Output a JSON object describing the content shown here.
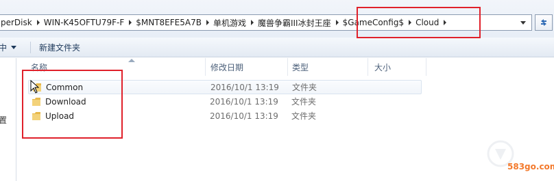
{
  "address_bar": {
    "breadcrumbs": [
      "perDisk",
      "WIN-K45OFTU79F-F",
      "$MNT8EFE5A7B",
      "单机游戏",
      "魔兽争霸III冰封王座",
      "$GameConfig$",
      "Cloud"
    ]
  },
  "toolbar": {
    "organize_label": "中",
    "new_folder_label": "新建文件夹"
  },
  "nav_pane": {
    "partial_label": "置"
  },
  "columns": {
    "name": "名称",
    "date": "修改日期",
    "type": "类型",
    "size": "大小"
  },
  "files": [
    {
      "name": "Common",
      "date": "2016/10/1 13:19",
      "type": "文件夹"
    },
    {
      "name": "Download",
      "date": "2016/10/1 13:19",
      "type": "文件夹"
    },
    {
      "name": "Upload",
      "date": "2016/10/1 13:19",
      "type": "文件夹"
    }
  ],
  "watermark": {
    "text": "583go.com"
  },
  "colors": {
    "annotation": "#e0202a",
    "folder": "#e8b84a",
    "watermark": "#f3792b"
  }
}
